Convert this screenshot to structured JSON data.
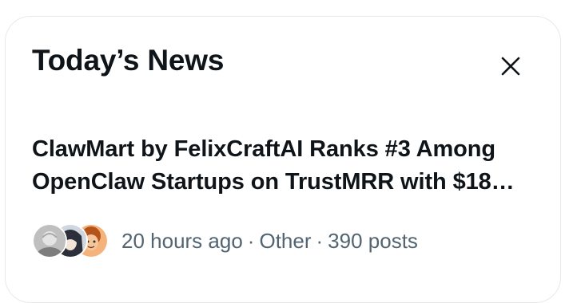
{
  "panel": {
    "title": "Today’s News",
    "close_icon": "close-icon"
  },
  "news": [
    {
      "headline": "ClawMart by FelixCraftAI Ranks #3 Among OpenClaw Startups on TrustMRR with $18…",
      "time": "20 hours ago",
      "separator": "·",
      "category": "Other",
      "posts": "390 posts",
      "avatars": [
        "avatar-bald-man-grayscale",
        "avatar-anime-dark-hair",
        "avatar-orange-curly-hair"
      ]
    }
  ],
  "colors": {
    "text_primary": "#0f1419",
    "text_secondary": "#536471",
    "border": "#e7e9ea",
    "background": "#ffffff"
  }
}
